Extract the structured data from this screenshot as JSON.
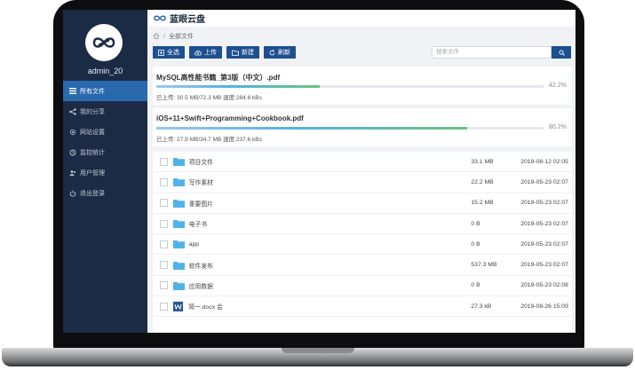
{
  "app": {
    "brand_name": "蓝眼云盘"
  },
  "user": {
    "name": "admin_20"
  },
  "sidebar": {
    "items": [
      {
        "label": "所有文件",
        "icon": "list-icon",
        "active": true
      },
      {
        "label": "我的分享",
        "icon": "share-icon",
        "active": false
      },
      {
        "label": "网站设置",
        "icon": "gear-icon",
        "active": false
      },
      {
        "label": "监控统计",
        "icon": "monitor-icon",
        "active": false
      },
      {
        "label": "用户管理",
        "icon": "users-icon",
        "active": false
      },
      {
        "label": "退出登录",
        "icon": "power-icon",
        "active": false
      }
    ]
  },
  "breadcrumb": {
    "home_icon": "home-icon",
    "separator": "/",
    "current": "全部文件"
  },
  "toolbar": {
    "select_all": "全选",
    "upload": "上传",
    "new_folder": "新建",
    "refresh": "刷新"
  },
  "search": {
    "placeholder": "搜索文件"
  },
  "uploads": [
    {
      "name": "MySQL高性能书籍_第3版（中文）.pdf",
      "progress": 0.422,
      "percent_text": "42.2%",
      "stats": "已上传: 30.5 MB/72.3 MB 速度:284.6 kBs"
    },
    {
      "name": "iOS+11+Swift+Programming+Cookbook.pdf",
      "progress": 0.802,
      "percent_text": "80.2%",
      "stats": "已上传: 27.9 MB/34.7 MB 速度:237.6 kBs"
    }
  ],
  "files": [
    {
      "name": "项目文件",
      "type": "folder",
      "size": "33.1 MB",
      "date": "2019-08-12 02:05"
    },
    {
      "name": "写作素材",
      "type": "folder",
      "size": "22.2 MB",
      "date": "2019-05-23 02:07"
    },
    {
      "name": "重要图片",
      "type": "folder",
      "size": "15.2 MB",
      "date": "2019-05-23 02:07"
    },
    {
      "name": "电子书",
      "type": "folder",
      "size": "0 B",
      "date": "2019-05-23 02:07"
    },
    {
      "name": "app",
      "type": "folder",
      "size": "0 B",
      "date": "2019-05-23 02:07"
    },
    {
      "name": "软件发布",
      "type": "folder",
      "size": "537.3 MB",
      "date": "2019-05-23 02:07"
    },
    {
      "name": "应用数据",
      "type": "folder",
      "size": "0 B",
      "date": "2019-05-23 02:08"
    },
    {
      "name": "简一.docx 会",
      "type": "docx",
      "size": "27.3 kB",
      "date": "2019-08-26 15:09"
    }
  ],
  "colors": {
    "sidebar_bg": "#1c2b45",
    "accent": "#2a69ad",
    "button": "#1e4f8f",
    "folder": "#4fb3e8"
  }
}
